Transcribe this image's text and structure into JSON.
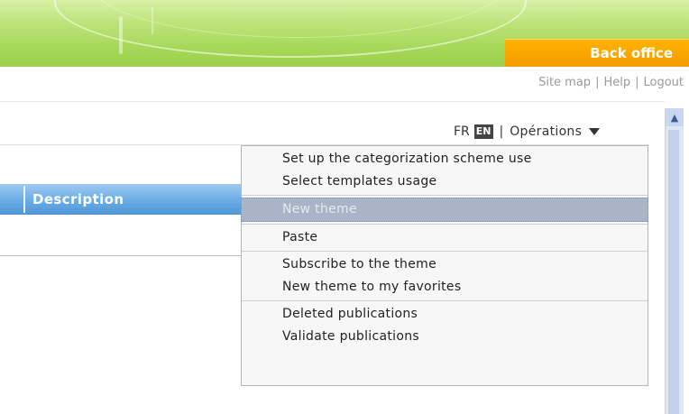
{
  "header": {
    "back_office_label": "Back office",
    "links": {
      "site_map": "Site map",
      "help": "Help",
      "logout": "Logout",
      "separator": "|"
    }
  },
  "toolbar": {
    "lang_fr": "FR",
    "lang_en": "EN",
    "separator": "|",
    "operations_label": "Opérations"
  },
  "table": {
    "columns": [
      "Description"
    ]
  },
  "menu": {
    "groups": [
      {
        "items": [
          {
            "label": "Set up the categorization scheme use",
            "enabled": true
          },
          {
            "label": "Select templates usage",
            "enabled": true
          }
        ]
      },
      {
        "items": [
          {
            "label": "New theme",
            "enabled": false
          }
        ]
      },
      {
        "items": [
          {
            "label": "Paste",
            "enabled": true
          }
        ]
      },
      {
        "items": [
          {
            "label": "Subscribe to the theme",
            "enabled": true
          },
          {
            "label": "New theme to my favorites",
            "enabled": true
          }
        ]
      },
      {
        "items": [
          {
            "label": "Deleted publications",
            "enabled": true
          },
          {
            "label": "Validate publications",
            "enabled": true
          }
        ]
      }
    ]
  },
  "colors": {
    "accent_orange": "#f59b00",
    "header_green": "#a7d85a",
    "table_header_blue": "#6caee6",
    "disabled_item": "#aab4c8"
  },
  "icons": {
    "operations_arrow": "triangle-down-icon",
    "scroll_up": "chevron-up-icon"
  }
}
